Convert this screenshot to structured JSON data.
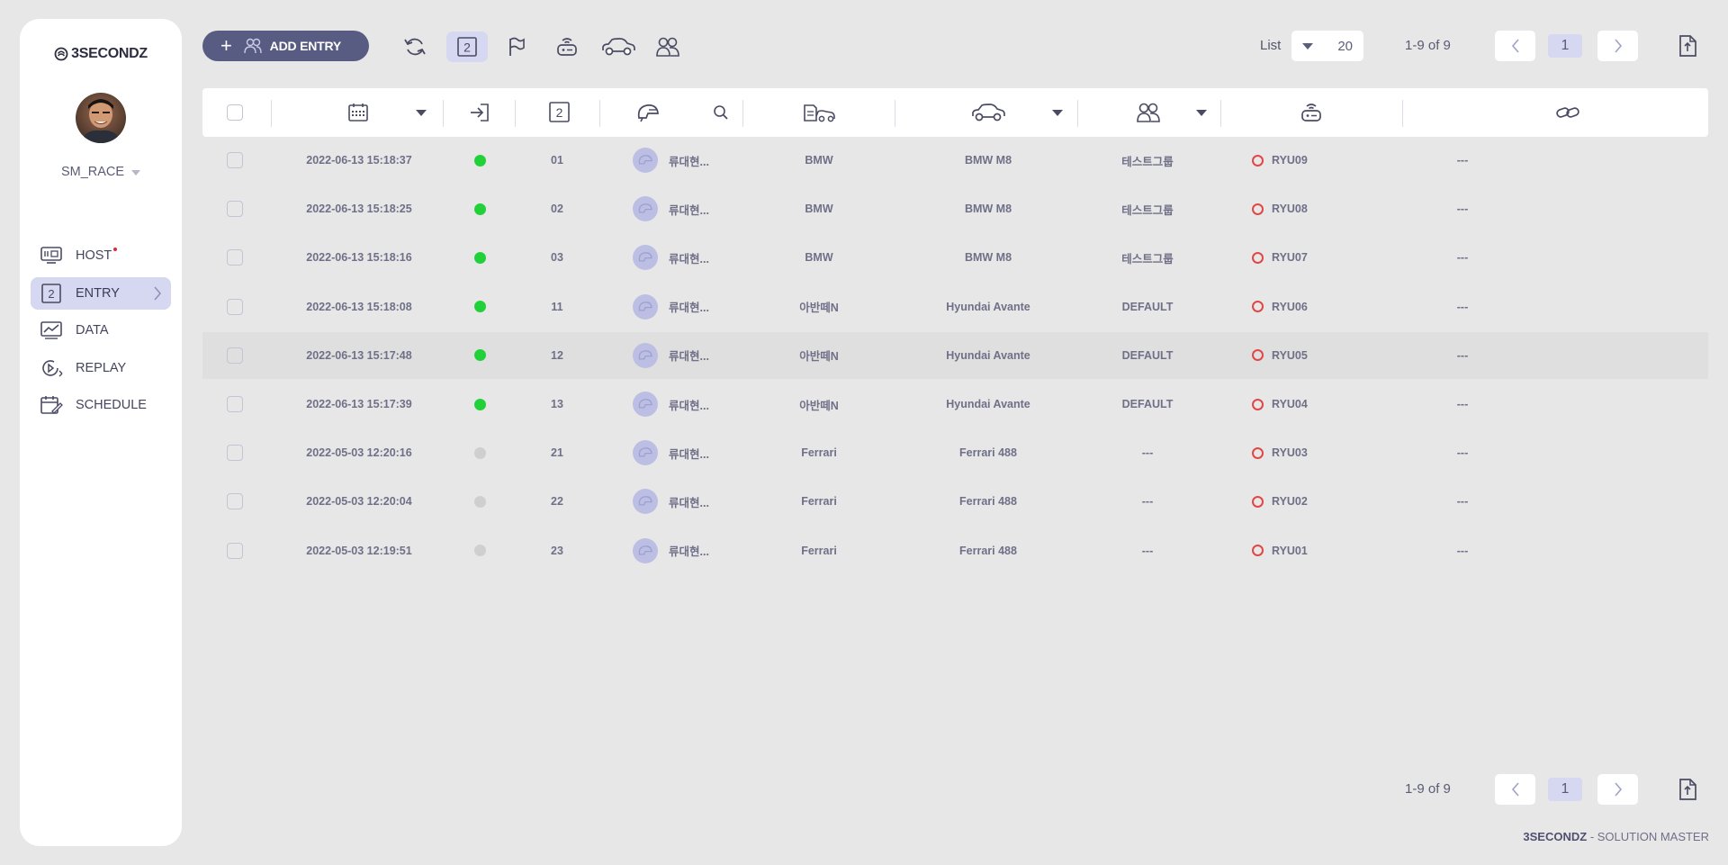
{
  "brand": {
    "logo_text": "3SECONDZ"
  },
  "user": {
    "name": "SM_RACE"
  },
  "nav": [
    {
      "label": "HOST",
      "icon": "host-icon"
    },
    {
      "label": "ENTRY",
      "icon": "entry-icon",
      "active": true
    },
    {
      "label": "DATA",
      "icon": "data-chart-icon"
    },
    {
      "label": "REPLAY",
      "icon": "replay-icon"
    },
    {
      "label": "SCHEDULE",
      "icon": "schedule-icon"
    }
  ],
  "toolbar": {
    "add_label": "ADD ENTRY",
    "entry_icon_number": "2",
    "list_label": "List",
    "list_value": "20",
    "range": "1-9 of 9",
    "page": "1"
  },
  "table": {
    "header_entry_number": "2",
    "rows": [
      {
        "time": "2022-06-13 15:18:37",
        "online": true,
        "no": "01",
        "driver": "류대현...",
        "maker": "BMW",
        "car": "BMW M8",
        "group": "테스트그룹",
        "device": "RYU09",
        "link": "---"
      },
      {
        "time": "2022-06-13 15:18:25",
        "online": true,
        "no": "02",
        "driver": "류대현...",
        "maker": "BMW",
        "car": "BMW M8",
        "group": "테스트그룹",
        "device": "RYU08",
        "link": "---"
      },
      {
        "time": "2022-06-13 15:18:16",
        "online": true,
        "no": "03",
        "driver": "류대현...",
        "maker": "BMW",
        "car": "BMW M8",
        "group": "테스트그룹",
        "device": "RYU07",
        "link": "---"
      },
      {
        "time": "2022-06-13 15:18:08",
        "online": true,
        "no": "11",
        "driver": "류대현...",
        "maker": "아반떼N",
        "car": "Hyundai Avante",
        "group": "DEFAULT",
        "device": "RYU06",
        "link": "---"
      },
      {
        "time": "2022-06-13 15:17:48",
        "online": true,
        "no": "12",
        "driver": "류대현...",
        "maker": "아반떼N",
        "car": "Hyundai Avante",
        "group": "DEFAULT",
        "device": "RYU05",
        "link": "---",
        "highlighted": true
      },
      {
        "time": "2022-06-13 15:17:39",
        "online": true,
        "no": "13",
        "driver": "류대현...",
        "maker": "아반떼N",
        "car": "Hyundai Avante",
        "group": "DEFAULT",
        "device": "RYU04",
        "link": "---"
      },
      {
        "time": "2022-05-03 12:20:16",
        "online": false,
        "no": "21",
        "driver": "류대현...",
        "maker": "Ferrari",
        "car": "Ferrari 488",
        "group": "---",
        "device": "RYU03",
        "link": "---"
      },
      {
        "time": "2022-05-03 12:20:04",
        "online": false,
        "no": "22",
        "driver": "류대현...",
        "maker": "Ferrari",
        "car": "Ferrari 488",
        "group": "---",
        "device": "RYU02",
        "link": "---"
      },
      {
        "time": "2022-05-03 12:19:51",
        "online": false,
        "no": "23",
        "driver": "류대현...",
        "maker": "Ferrari",
        "car": "Ferrari 488",
        "group": "---",
        "device": "RYU01",
        "link": "---"
      }
    ]
  },
  "footer": {
    "range": "1-9 of 9",
    "page": "1",
    "brand_bold": "3SECONDZ",
    "brand_rest": " - SOLUTION MASTER"
  },
  "colors": {
    "accent": "#585c82",
    "active_bg": "#d6d7f0",
    "online": "#22d13a",
    "offline": "#cfcfcf",
    "device_ring": "#e04848"
  }
}
